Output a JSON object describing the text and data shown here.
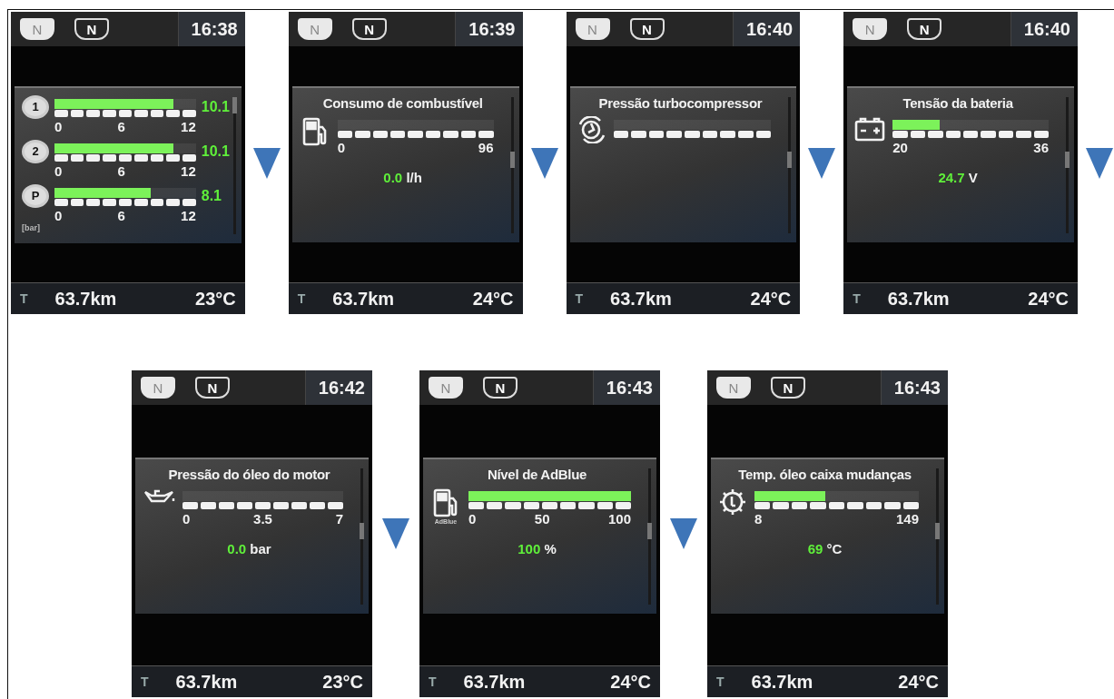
{
  "rows": [
    {
      "screens": [
        {
          "time": "16:38",
          "badges": [
            {
              "label": "N",
              "kind": "filled"
            },
            {
              "label": "N",
              "kind": "outlined"
            }
          ],
          "trip": {
            "label": "T",
            "distance": "63.7km",
            "temperature": "23°C"
          },
          "arrow_after": true,
          "panel": {
            "kind": "brake_pressure",
            "unit_label": "[bar]",
            "gauges": [
              {
                "icon_label": "1",
                "level": 0.84,
                "ticks": [
                  "0",
                  "6",
                  "12"
                ],
                "reading": "10.1"
              },
              {
                "icon_label": "2",
                "level": 0.84,
                "ticks": [
                  "0",
                  "6",
                  "12"
                ],
                "reading": "10.1"
              },
              {
                "icon_label": "P",
                "level": 0.68,
                "ticks": [
                  "0",
                  "6",
                  "12"
                ],
                "reading": "8.1"
              }
            ]
          }
        },
        {
          "time": "16:39",
          "badges": [
            {
              "label": "N",
              "kind": "filled"
            },
            {
              "label": "N",
              "kind": "outlined"
            }
          ],
          "trip": {
            "label": "T",
            "distance": "63.7km",
            "temperature": "24°C"
          },
          "arrow_after": true,
          "panel": {
            "kind": "fuel_consumption",
            "title": "Consumo de combustível",
            "ticks": [
              "0",
              "96"
            ],
            "reading": "0.0",
            "unit": "l/h"
          }
        },
        {
          "time": "16:40",
          "badges": [
            {
              "label": "N",
              "kind": "filled"
            },
            {
              "label": "N",
              "kind": "outlined"
            }
          ],
          "trip": {
            "label": "T",
            "distance": "63.7km",
            "temperature": "24°C"
          },
          "arrow_after": true,
          "panel": {
            "kind": "turbo_pressure",
            "title": "Pressão turbocompressor"
          }
        },
        {
          "time": "16:40",
          "badges": [
            {
              "label": "N",
              "kind": "filled"
            },
            {
              "label": "N",
              "kind": "outlined"
            }
          ],
          "trip": {
            "label": "T",
            "distance": "63.7km",
            "temperature": "24°C"
          },
          "arrow_after": true,
          "panel": {
            "kind": "battery_voltage",
            "title": "Tensão da bateria",
            "level": 0.3,
            "ticks": [
              "20",
              "36"
            ],
            "reading": "24.7",
            "unit": "V"
          }
        }
      ]
    },
    {
      "screens": [
        {
          "time": "16:42",
          "badges": [
            {
              "label": "N",
              "kind": "filled"
            },
            {
              "label": "N",
              "kind": "outlined"
            }
          ],
          "trip": {
            "label": "T",
            "distance": "63.7km",
            "temperature": "23°C"
          },
          "arrow_after": true,
          "panel": {
            "kind": "oil_pressure",
            "title": "Pressão do óleo do motor",
            "ticks": [
              "0",
              "3.5",
              "7"
            ],
            "reading": "0.0",
            "unit": "bar"
          }
        },
        {
          "time": "16:43",
          "badges": [
            {
              "label": "N",
              "kind": "filled"
            },
            {
              "label": "N",
              "kind": "outlined"
            }
          ],
          "trip": {
            "label": "T",
            "distance": "63.7km",
            "temperature": "24°C"
          },
          "arrow_after": true,
          "panel": {
            "kind": "adblue_level",
            "title": "Nível de AdBlue",
            "icon_label": "AdBlue",
            "level": 1,
            "ticks": [
              "0",
              "50",
              "100"
            ],
            "reading": "100",
            "unit": "%"
          }
        },
        {
          "time": "16:43",
          "badges": [
            {
              "label": "N",
              "kind": "filled"
            },
            {
              "label": "N",
              "kind": "outlined"
            }
          ],
          "trip": {
            "label": "T",
            "distance": "63.7km",
            "temperature": "24°C"
          },
          "arrow_after": false,
          "panel": {
            "kind": "gearbox_oil_temp",
            "title": "Temp. óleo caixa mudanças",
            "level": 0.43,
            "ticks": [
              "8",
              "149"
            ],
            "reading": "69",
            "unit": "°C"
          }
        }
      ]
    }
  ]
}
